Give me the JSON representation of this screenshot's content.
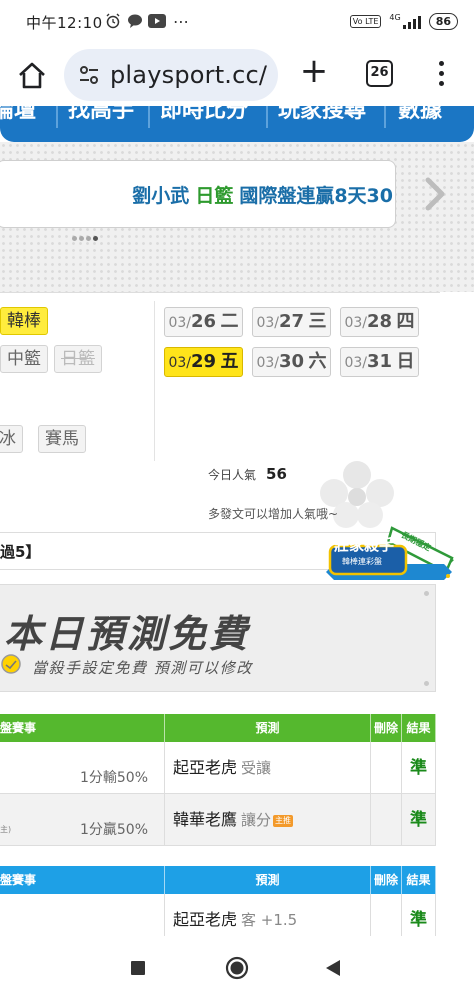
{
  "status_bar": {
    "time": "中午12:10",
    "network": "4G",
    "volte": "Vo LTE",
    "battery": "86"
  },
  "browser": {
    "url": "playsport.cc/",
    "tab_count": "26"
  },
  "topnav": {
    "items": [
      "論壇",
      "找高手",
      "即時比分",
      "玩家搜尋",
      "數據"
    ]
  },
  "banner": {
    "name": "劉小武",
    "league": "日籃",
    "text": "國際盤連贏8天30"
  },
  "sports": {
    "items": [
      {
        "label": "韓棒",
        "state": "active"
      },
      {
        "label": "中籃",
        "state": "normal"
      },
      {
        "label": "日籃",
        "state": "disabled"
      },
      {
        "label": "冰",
        "state": "normal"
      },
      {
        "label": "賽馬",
        "state": "normal"
      }
    ]
  },
  "dates": [
    {
      "date": "03/",
      "day": "26",
      "weekday": "二",
      "active": false
    },
    {
      "date": "03/",
      "day": "27",
      "weekday": "三",
      "active": false
    },
    {
      "date": "03/",
      "day": "28",
      "weekday": "四",
      "active": false
    },
    {
      "date": "03/",
      "day": "29",
      "weekday": "五",
      "active": true
    },
    {
      "date": "03/",
      "day": "30",
      "weekday": "六",
      "active": false
    },
    {
      "date": "03/",
      "day": "31",
      "weekday": "日",
      "active": false
    }
  ],
  "popularity": {
    "label": "今日人氣",
    "value": "56",
    "note": "多發文可以增加人氣哦~"
  },
  "section": {
    "title": "過5】",
    "badge_main": "莊家殺手",
    "badge_sub": "韓棒連彩盤",
    "badge_ribbon": "長期穩定"
  },
  "promo": {
    "title": "本日預測免費",
    "subtitle": "當殺手設定免費 預測可以修改"
  },
  "table1": {
    "header_color": "#55b82e",
    "headers": [
      "盤賽事",
      "預測",
      "刪除",
      "結果"
    ],
    "rows": [
      {
        "odds": "1分輸50%",
        "tiny": "",
        "team": "起亞老虎",
        "market": "受讓",
        "tag": "",
        "result": "準"
      },
      {
        "odds": "1分贏50%",
        "tiny": "主)",
        "team": "韓華老鷹",
        "market": "讓分",
        "tag": "主推",
        "result": "準"
      }
    ]
  },
  "table2": {
    "header_color": "#1ea0e6",
    "headers": [
      "盤賽事",
      "預測",
      "刪除",
      "結果"
    ],
    "rows": [
      {
        "odds": "",
        "tiny": "",
        "team": "起亞老虎",
        "market": "客 +1.5",
        "tag": "",
        "result": "準"
      }
    ]
  },
  "colors": {
    "nav_blue": "#1b76c4",
    "active_yellow": "#ffe41a",
    "result_green": "#1a8a1a"
  }
}
